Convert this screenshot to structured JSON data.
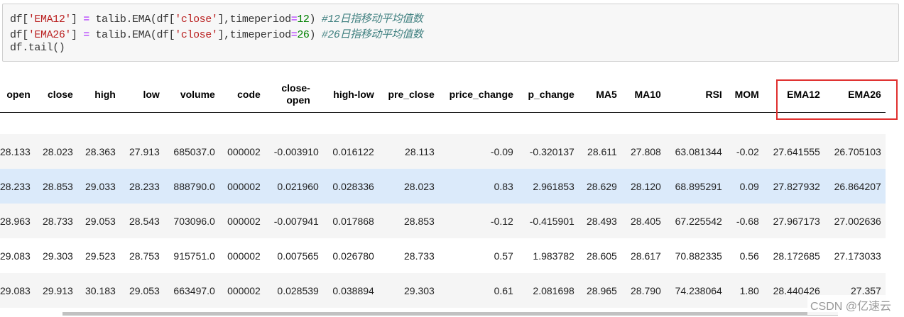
{
  "code": {
    "lines": [
      {
        "a": "df[",
        "s1": "'EMA12'",
        "b": "] ",
        "op": "=",
        "c": " talib.EMA(df[",
        "s2": "'close'",
        "d": "],timeperiod",
        "op2": "=",
        "n": "12",
        "e": ") ",
        "cm": "#12日指移动平均值数"
      },
      {
        "a": "df[",
        "s1": "'EMA26'",
        "b": "] ",
        "op": "=",
        "c": " talib.EMA(df[",
        "s2": "'close'",
        "d": "],timeperiod",
        "op2": "=",
        "n": "26",
        "e": ") ",
        "cm": "#26日指移动平均值数"
      },
      {
        "a": "df.tail()"
      }
    ]
  },
  "table": {
    "columns": [
      "open",
      "close",
      "high",
      "low",
      "volume",
      "code",
      "close-open",
      "high-low",
      "pre_close",
      "price_change",
      "p_change",
      "MA5",
      "MA10",
      "RSI",
      "MOM",
      "EMA12",
      "EMA26"
    ],
    "rows": [
      [
        "28.133",
        "28.023",
        "28.363",
        "27.913",
        "685037.0",
        "000002",
        "-0.003910",
        "0.016122",
        "28.113",
        "-0.09",
        "-0.320137",
        "28.611",
        "27.808",
        "63.081344",
        "-0.02",
        "27.641555",
        "26.705103"
      ],
      [
        "28.233",
        "28.853",
        "29.033",
        "28.233",
        "888790.0",
        "000002",
        "0.021960",
        "0.028336",
        "28.023",
        "0.83",
        "2.961853",
        "28.629",
        "28.120",
        "68.895291",
        "0.09",
        "27.827932",
        "26.864207"
      ],
      [
        "28.963",
        "28.733",
        "29.053",
        "28.543",
        "703096.0",
        "000002",
        "-0.007941",
        "0.017868",
        "28.853",
        "-0.12",
        "-0.415901",
        "28.493",
        "28.405",
        "67.225542",
        "-0.68",
        "27.967173",
        "27.002636"
      ],
      [
        "29.083",
        "29.303",
        "29.523",
        "28.753",
        "915751.0",
        "000002",
        "0.007565",
        "0.026780",
        "28.733",
        "0.57",
        "1.983782",
        "28.605",
        "28.617",
        "70.882335",
        "0.56",
        "28.172685",
        "27.173033"
      ],
      [
        "29.083",
        "29.913",
        "30.183",
        "29.053",
        "663497.0",
        "000002",
        "0.028539",
        "0.038894",
        "29.303",
        "0.61",
        "2.081698",
        "28.965",
        "28.790",
        "74.238064",
        "1.80",
        "28.440426",
        "27.357"
      ]
    ]
  },
  "watermark": "CSDN @亿速云"
}
